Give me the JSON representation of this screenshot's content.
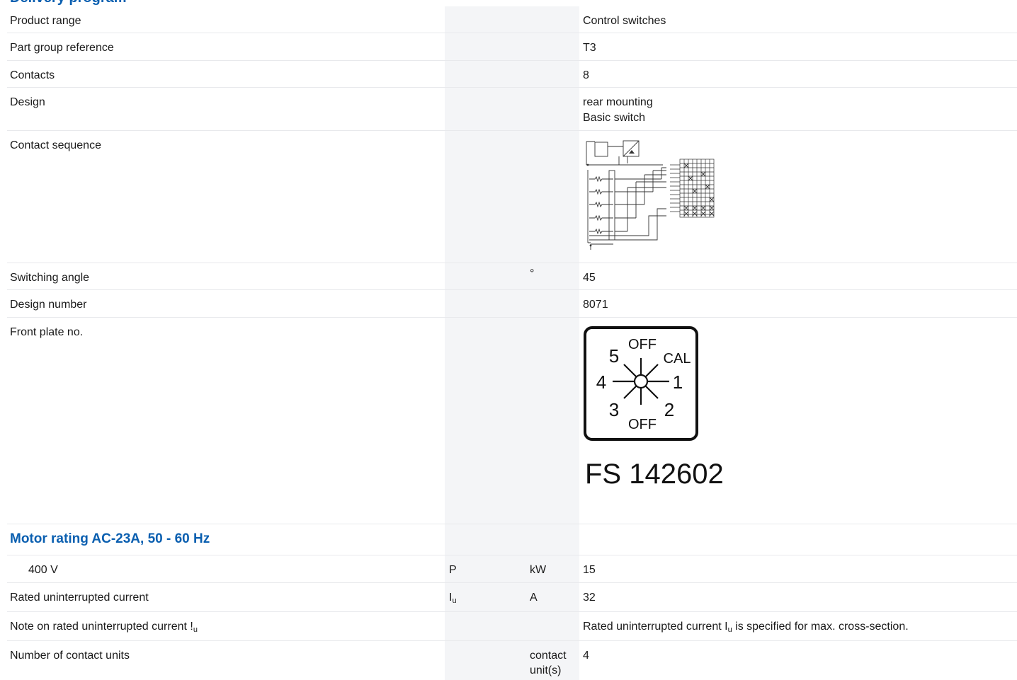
{
  "header": {
    "title": "Delivery program"
  },
  "rows": [
    {
      "label": "Product range",
      "symbol": "",
      "unit": "",
      "value": "Control switches"
    },
    {
      "label": "Part group reference",
      "symbol": "",
      "unit": "",
      "value": "T3"
    },
    {
      "label": "Contacts",
      "symbol": "",
      "unit": "",
      "value": "8"
    },
    {
      "label": "Design",
      "symbol": "",
      "unit": "",
      "value_lines": [
        "rear mounting",
        "Basic switch"
      ]
    },
    {
      "label": "Contact sequence",
      "symbol": "",
      "unit": "",
      "value": ""
    },
    {
      "label": "Switching angle",
      "symbol": "",
      "unit": "°",
      "value": "45"
    },
    {
      "label": "Design number",
      "symbol": "",
      "unit": "",
      "value": "8071"
    },
    {
      "label": "Front plate no.",
      "symbol": "",
      "unit": "",
      "value": ""
    }
  ],
  "front_plate": {
    "positions": [
      "OFF",
      "CAL",
      "1",
      "2",
      "OFF",
      "3",
      "4",
      "5"
    ],
    "caption": "FS 142602"
  },
  "section_motor": {
    "title": "Motor rating AC-23A, 50 - 60 Hz"
  },
  "rows2": [
    {
      "label": "400 V",
      "symbol": "P",
      "unit": "kW",
      "value": "15"
    },
    {
      "label": "Rated uninterrupted current",
      "symbol_main": "I",
      "symbol_sub": "u",
      "unit": "A",
      "value": "32"
    },
    {
      "label_main": "Note on rated uninterrupted current !",
      "label_sub": "u",
      "value_pre": "Rated uninterrupted current I",
      "value_sub": "u",
      "value_post": " is specified for max. cross-section."
    },
    {
      "label": "Number of contact units",
      "symbol": "",
      "unit": "contact unit(s)",
      "value": "4"
    }
  ]
}
